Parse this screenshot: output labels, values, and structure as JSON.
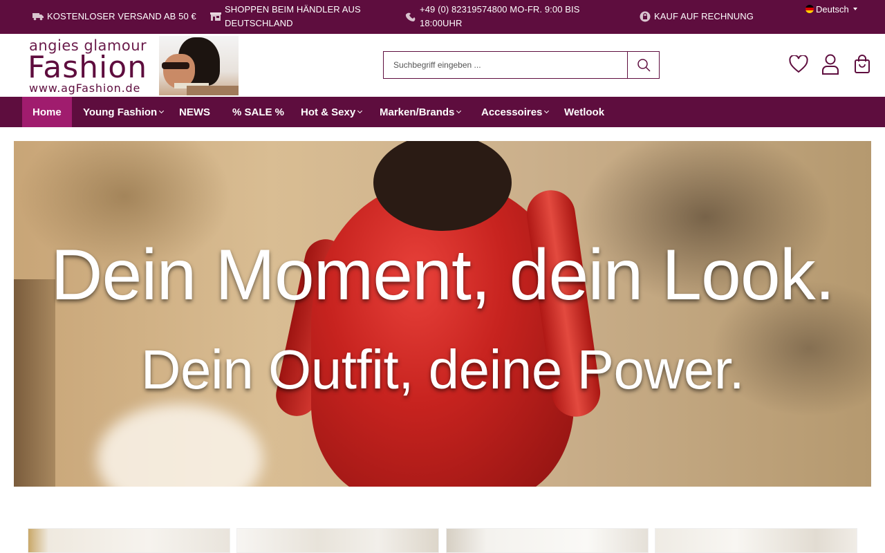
{
  "topbar": {
    "usps": [
      {
        "icon": "truck-icon",
        "text": "KOSTENLOSER VERSAND AB 50 €"
      },
      {
        "icon": "store-icon",
        "text": "SHOPPEN BEIM HÄNDLER AUS DEUTSCHLAND"
      },
      {
        "icon": "phone-icon",
        "text": "+49 (0) 82319574800 MO-FR. 9:00 BIS 18:00UHR"
      },
      {
        "icon": "lock-icon",
        "text": "KAUF AUF RECHNUNG"
      }
    ],
    "language": "Deutsch"
  },
  "header": {
    "logo": {
      "line1": "angies glamour",
      "line2": "Fashion",
      "line3": "www.agFashion.de"
    },
    "search_placeholder": "Suchbegriff eingeben ...",
    "icons": [
      "heart-icon",
      "user-icon",
      "bag-icon"
    ]
  },
  "nav": {
    "items": [
      {
        "label": "Home",
        "active": true,
        "dropdown": false
      },
      {
        "label": "Young Fashion",
        "active": false,
        "dropdown": true
      },
      {
        "label": "NEWS",
        "active": false,
        "dropdown": false
      },
      {
        "label": "% SALE %",
        "active": false,
        "dropdown": false
      },
      {
        "label": "Hot & Sexy",
        "active": false,
        "dropdown": true
      },
      {
        "label": "Marken/Brands",
        "active": false,
        "dropdown": true
      },
      {
        "label": "Accessoires",
        "active": false,
        "dropdown": true
      },
      {
        "label": "Wetlook",
        "active": false,
        "dropdown": false
      }
    ]
  },
  "hero": {
    "headline": "Dein Moment, dein Look.",
    "subheadline": "Dein Outfit, deine Power."
  },
  "colors": {
    "brand": "#5e0d3e",
    "nav_active": "#a01c6e",
    "white": "#ffffff"
  }
}
